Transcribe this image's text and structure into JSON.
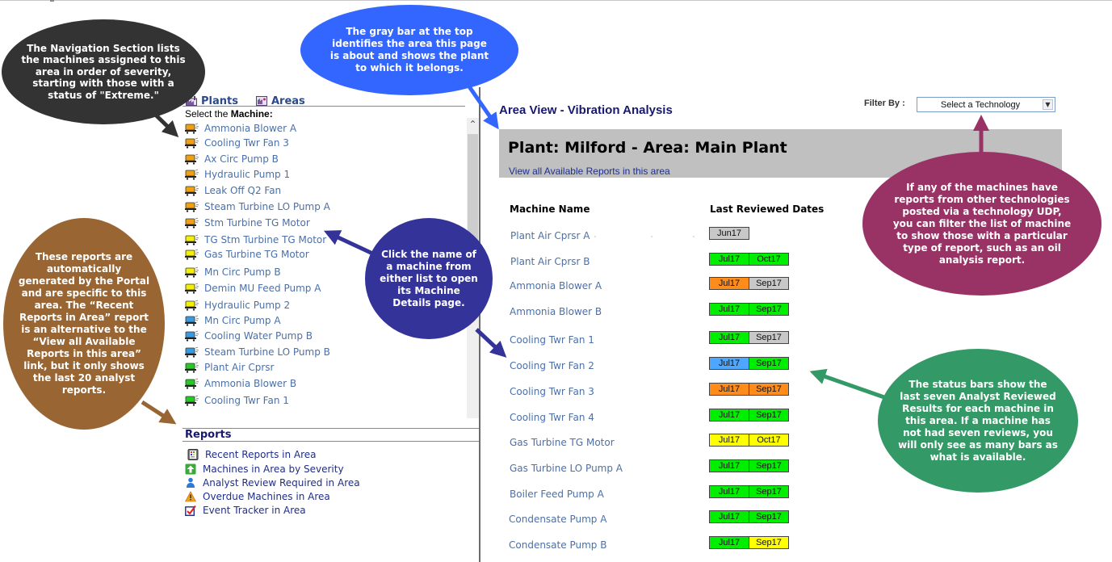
{
  "nav": {
    "tabs": [
      {
        "label": "Plants",
        "icon": "plant-icon"
      },
      {
        "label": "Areas",
        "icon": "area-icon"
      }
    ],
    "select_prefix": "Select the ",
    "select_bold": "Machine:",
    "machines": [
      {
        "name": "Ammonia Blower A",
        "status": "orange"
      },
      {
        "name": "Cooling Twr Fan 3",
        "status": "orange"
      },
      {
        "name": "Ax Circ Pump B",
        "status": "orange"
      },
      {
        "name": "Hydraulic Pump 1",
        "status": "orange"
      },
      {
        "name": "Leak Off Q2 Fan",
        "status": "orange"
      },
      {
        "name": "Steam Turbine LO Pump A",
        "status": "orange"
      },
      {
        "name": "Stm Turbine TG Motor",
        "status": "orange"
      },
      {
        "name": "TG Stm Turbine TG Motor",
        "status": "yellow"
      },
      {
        "name": "Gas Turbine TG Motor",
        "status": "yellow"
      },
      {
        "name": "Mn Circ Pump B",
        "status": "yellow"
      },
      {
        "name": "Demin MU Feed Pump A",
        "status": "yellow"
      },
      {
        "name": "Hydraulic Pump 2",
        "status": "yellow"
      },
      {
        "name": "Mn Circ Pump A",
        "status": "blue"
      },
      {
        "name": "Cooling Water Pump B",
        "status": "blue"
      },
      {
        "name": "Steam Turbine LO Pump B",
        "status": "blue"
      },
      {
        "name": "Plant Air Cprsr",
        "status": "green"
      },
      {
        "name": "Ammonia Blower B",
        "status": "green"
      },
      {
        "name": "Cooling Twr Fan 1",
        "status": "green"
      }
    ],
    "reports_title": "Reports",
    "reports": [
      {
        "label": "Recent Reports in Area",
        "icon": "recent-reports-icon"
      },
      {
        "label": "Machines in Area by Severity",
        "icon": "severity-up-arrow-icon"
      },
      {
        "label": "Analyst Review Required in Area",
        "icon": "analyst-person-icon"
      },
      {
        "label": "Overdue Machines in Area",
        "icon": "warning-triangle-icon"
      },
      {
        "label": "Event Tracker in Area",
        "icon": "checkbox-check-icon"
      }
    ]
  },
  "main": {
    "title": "Area View - Vibration Analysis",
    "filter_label": "Filter By :",
    "filter_value": "Select a Technology",
    "plant_area_title": "Plant: Milford - Area: Main Plant",
    "view_reports_link": "View all Available Reports in this area",
    "columns": [
      "Machine Name",
      "Last Reviewed Dates"
    ],
    "rows": [
      {
        "name": "Plant Air Cprsr  A",
        "bars": [
          {
            "label": "Jun17",
            "status": "gray"
          }
        ]
      },
      {
        "name": "Plant Air Cprsr  B",
        "bars": [
          {
            "label": "Jul17",
            "status": "green"
          },
          {
            "label": "Oct17",
            "status": "green"
          }
        ]
      },
      {
        "name": "Ammonia Blower A",
        "bars": [
          {
            "label": "Jul17",
            "status": "orange"
          },
          {
            "label": "Sep17",
            "status": "gray"
          }
        ]
      },
      {
        "name": "Ammonia Blower B",
        "bars": [
          {
            "label": "Jul17",
            "status": "green"
          },
          {
            "label": "Sep17",
            "status": "green"
          }
        ]
      },
      {
        "name": "Cooling Twr Fan 1",
        "bars": [
          {
            "label": "Jul17",
            "status": "green"
          },
          {
            "label": "Sep17",
            "status": "gray"
          }
        ]
      },
      {
        "name": "Cooling Twr Fan 2",
        "bars": [
          {
            "label": "Jul17",
            "status": "blue"
          },
          {
            "label": "Sep17",
            "status": "green"
          }
        ]
      },
      {
        "name": "Cooling Twr Fan 3",
        "bars": [
          {
            "label": "Jul17",
            "status": "orange"
          },
          {
            "label": "Sep17",
            "status": "orange"
          }
        ]
      },
      {
        "name": "Cooling Twr Fan 4",
        "bars": [
          {
            "label": "Jul17",
            "status": "green"
          },
          {
            "label": "Sep17",
            "status": "green"
          }
        ]
      },
      {
        "name": "Gas Turbine TG Motor",
        "bars": [
          {
            "label": "Jul17",
            "status": "yellow"
          },
          {
            "label": "Oct17",
            "status": "yellow"
          }
        ]
      },
      {
        "name": "Gas Turbine LO Pump A",
        "bars": [
          {
            "label": "Jul17",
            "status": "green"
          },
          {
            "label": "Sep17",
            "status": "green"
          }
        ]
      },
      {
        "name": "Boiler Feed Pump A",
        "bars": [
          {
            "label": "Jul17",
            "status": "green"
          },
          {
            "label": "Sep17",
            "status": "green"
          }
        ]
      },
      {
        "name": "Condensate Pump A",
        "bars": [
          {
            "label": "Jul17",
            "status": "green"
          },
          {
            "label": "Sep17",
            "status": "green"
          }
        ]
      },
      {
        "name": "Condensate Pump B",
        "bars": [
          {
            "label": "Jul17",
            "status": "green"
          },
          {
            "label": "Sep17",
            "status": "yellow"
          }
        ]
      }
    ]
  },
  "status_colors": {
    "green": "#00ee00",
    "orange": "#ff8c1a",
    "gray": "#c8c8c8",
    "blue": "#4da6ff",
    "yellow": "#ffff00"
  },
  "callouts": {
    "navigation": "The Navigation Section lists the machines assigned to this area in order of severity, starting with those with a status of \"Extreme.\"",
    "gray_bar": "The gray bar at the top identifies the area this page is about and shows the plant to which it belongs.",
    "reports": "These reports are automatically generated by the Portal and are specific to this area. The “Recent Reports in Area” report is an alternative to the “View all Available Reports in this area” link, but it only shows the last 20 analyst reports.",
    "click_machine": "Click the name of a machine from either list to open its Machine Details page.",
    "filter": "If any of the machines have reports from other technologies posted via a technology UDP, you can filter the list of machine to show those with a particular type of report, such as an oil analysis report.",
    "status_bars": "The status bars show the last seven Analyst Reviewed Results for each machine in this area. If a machine has not had seven reviews, you will only see as many bars as what is available."
  }
}
